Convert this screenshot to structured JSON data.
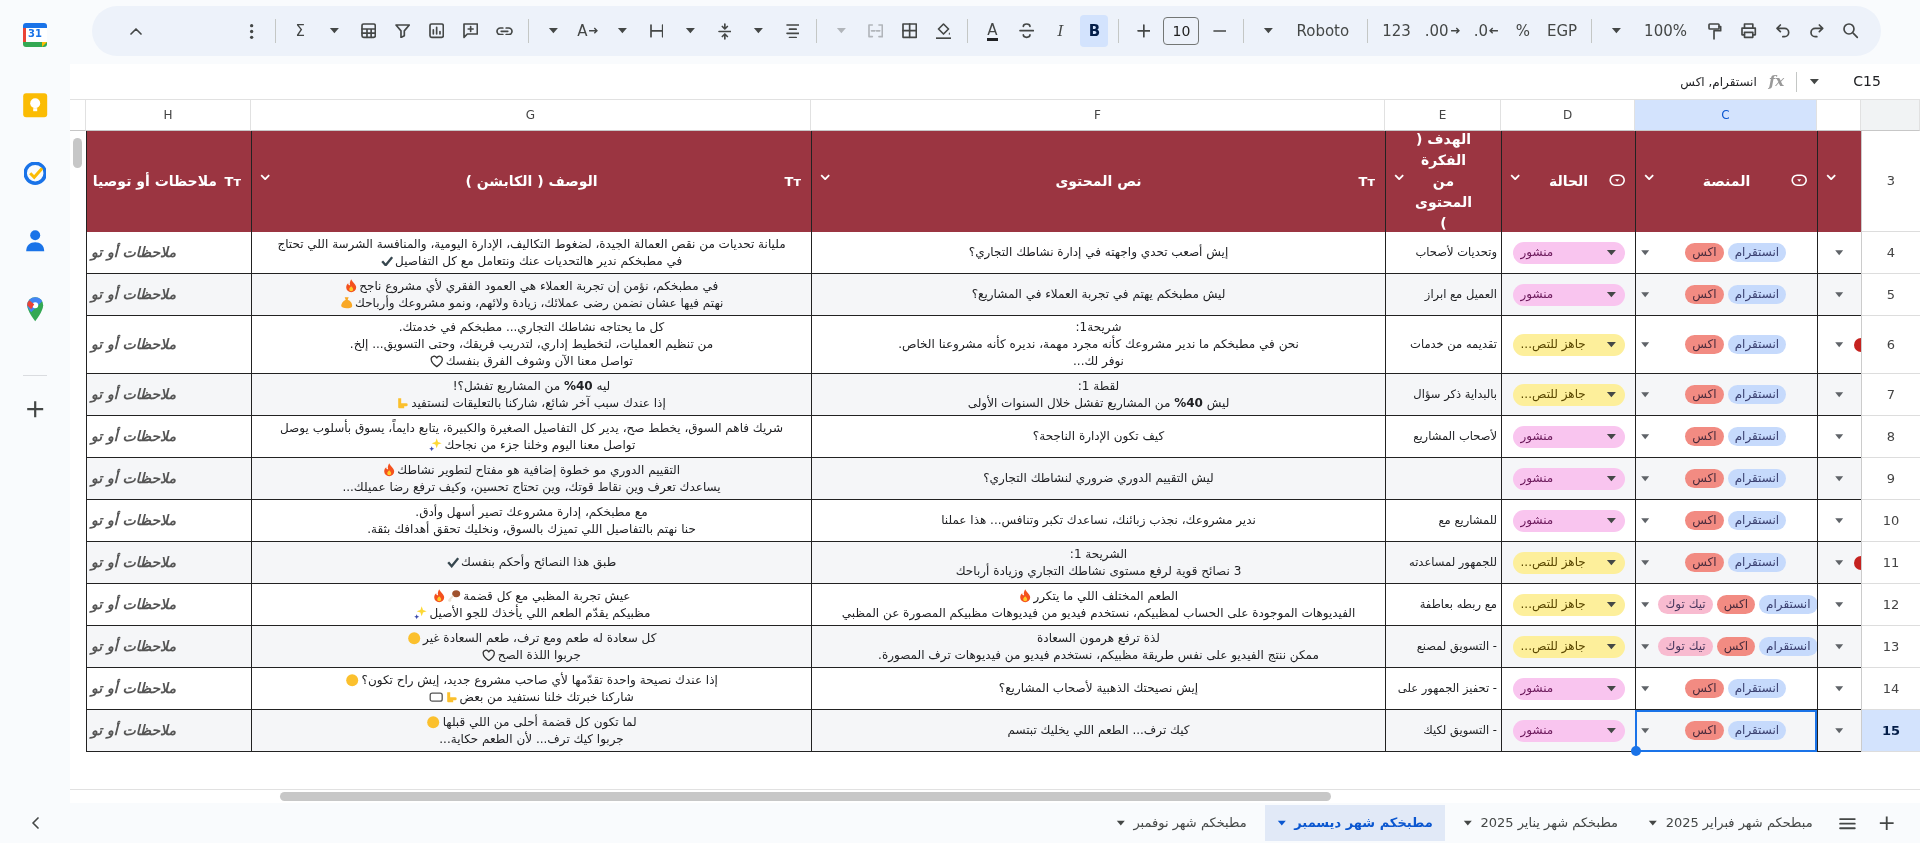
{
  "side_panel": {
    "calendar_day": "31",
    "apps": [
      {
        "kind": "calendar"
      },
      {
        "kind": "keep"
      },
      {
        "kind": "tasks"
      },
      {
        "kind": "contacts"
      },
      {
        "kind": "maps"
      },
      {
        "kind": "add"
      }
    ]
  },
  "toolbar": [
    {
      "kind": "search",
      "disabled": false,
      "active": false
    },
    {
      "kind": "redo",
      "disabled": false,
      "active": false
    },
    {
      "kind": "undo",
      "disabled": false,
      "active": false
    },
    {
      "kind": "print",
      "disabled": false,
      "active": false
    },
    {
      "kind": "paint_format",
      "disabled": false,
      "active": false
    },
    {
      "kind": "zoom",
      "label": "100%",
      "disabled": false,
      "active": false
    },
    {
      "kind": "caret",
      "disabled": false,
      "active": false
    },
    {
      "kind": "separator"
    },
    {
      "kind": "currency",
      "label": "EGP",
      "disabled": false,
      "active": false
    },
    {
      "kind": "percent",
      "label": "%",
      "disabled": false,
      "active": false
    },
    {
      "kind": "decimal_less",
      "label": ".0",
      "disabled": false,
      "active": false
    },
    {
      "kind": "decimal_more",
      "label": ".00",
      "disabled": false,
      "active": false
    },
    {
      "kind": "number_format",
      "label": "123",
      "disabled": false,
      "active": false
    },
    {
      "kind": "separator"
    },
    {
      "kind": "font",
      "label": "Roboto",
      "disabled": false,
      "active": false
    },
    {
      "kind": "caret",
      "disabled": false,
      "active": false
    },
    {
      "kind": "separator"
    },
    {
      "kind": "decrease",
      "disabled": false,
      "active": false
    },
    {
      "kind": "font_size",
      "value": "10",
      "disabled": false,
      "active": false
    },
    {
      "kind": "increase",
      "disabled": false,
      "active": false
    },
    {
      "kind": "separator"
    },
    {
      "kind": "bold",
      "label": "B",
      "disabled": false,
      "active": true
    },
    {
      "kind": "italic",
      "label": "I",
      "disabled": false,
      "active": false
    },
    {
      "kind": "strike",
      "disabled": false,
      "active": false
    },
    {
      "kind": "text_color",
      "label": "A",
      "disabled": false,
      "active": false
    },
    {
      "kind": "separator"
    },
    {
      "kind": "fill",
      "disabled": false,
      "active": false
    },
    {
      "kind": "borders",
      "disabled": false,
      "active": false
    },
    {
      "kind": "merge",
      "disabled": true,
      "active": false
    },
    {
      "kind": "caret",
      "disabled": true,
      "active": false
    },
    {
      "kind": "separator"
    },
    {
      "kind": "halign",
      "disabled": false,
      "active": false
    },
    {
      "kind": "caret",
      "disabled": false,
      "active": false
    },
    {
      "kind": "valign",
      "disabled": false,
      "active": false
    },
    {
      "kind": "caret",
      "disabled": false,
      "active": false
    },
    {
      "kind": "wrap",
      "disabled": false,
      "active": false
    },
    {
      "kind": "caret",
      "disabled": false,
      "active": false
    },
    {
      "kind": "rotate",
      "label": "A",
      "disabled": false,
      "active": false
    },
    {
      "kind": "caret",
      "disabled": false,
      "active": false
    },
    {
      "kind": "separator"
    },
    {
      "kind": "link",
      "disabled": false,
      "active": false
    },
    {
      "kind": "comment",
      "disabled": false,
      "active": false
    },
    {
      "kind": "chart",
      "disabled": false,
      "active": false
    },
    {
      "kind": "filter",
      "disabled": false,
      "active": false
    },
    {
      "kind": "table",
      "disabled": false,
      "active": false
    },
    {
      "kind": "caret",
      "disabled": false,
      "active": false
    },
    {
      "kind": "sum",
      "label": "Σ",
      "disabled": false,
      "active": false
    },
    {
      "kind": "separator"
    },
    {
      "kind": "more",
      "disabled": false,
      "active": false
    },
    {
      "kind": "spacer"
    },
    {
      "kind": "collapse",
      "disabled": false,
      "active": false
    }
  ],
  "formula_bar": {
    "name_box": "C15",
    "fx": "fx",
    "content": "انستقرام, اكس"
  },
  "columns": [
    {
      "selected": false
    },
    {
      "letter": "C",
      "selected": true
    },
    {
      "letter": "D",
      "selected": false
    },
    {
      "letter": "E",
      "selected": false
    },
    {
      "letter": "F",
      "selected": false
    },
    {
      "letter": "G",
      "selected": false
    },
    {
      "letter": "H",
      "selected": false
    }
  ],
  "header_row": {
    "number": "3",
    "cells": [
      {
        "kind": "empty",
        "filter_menu": true
      },
      {
        "kind": "dropdown",
        "label": "المنصة",
        "filter_menu": true
      },
      {
        "kind": "dropdown",
        "label": "الحالة",
        "filter_menu": true
      },
      {
        "kind": "text",
        "label": "الهدف ( الفكرة من المحتوى )",
        "filter_menu": true
      },
      {
        "kind": "text",
        "label": "نص المحتوى",
        "type_icon": "Tт",
        "filter_menu": true
      },
      {
        "kind": "text",
        "label": "الوصف ( الكابشن )",
        "type_icon": "Tт",
        "filter_menu": true
      },
      {
        "kind": "text",
        "label": "ملاحظات أو توصيا",
        "type_icon": "Tт",
        "filter_menu": false
      }
    ]
  },
  "rows": [
    {
      "number": "4",
      "selected": false,
      "flag": false,
      "notes": "ملاحظات أو تو",
      "caption": [
        {
          "text": "مليانة تحديات من نقص العمالة الجيدة، لضغوط التكاليف، الإدارة اليومية، والمنافسة الشرسة اللي تحتاج"
        },
        {
          "text": "في مطبخكم ندير هالتحديات عنك ونتعامل مع كل التفاصيل",
          "icons": [
            {
              "kind": "check"
            }
          ]
        }
      ],
      "content": [
        {
          "text": "إيش أصعب تحدي واجهته في إدارة نشاطك التجاري؟"
        }
      ],
      "goal": "وتحديات لأصحاب",
      "status": {
        "kind": "published",
        "label": "منشور"
      },
      "platforms": [
        {
          "label": "انستقرام",
          "color": "#c6dafc"
        },
        {
          "label": "اكس",
          "color": "#f28b82"
        }
      ]
    },
    {
      "number": "5",
      "selected": false,
      "flag": false,
      "notes": "ملاحظات أو تو",
      "caption": [
        {
          "text": "في مطبخكم، نؤمن إن تجربة العملاء هي العمود الفقري لأي مشروع ناجح",
          "icons": [
            {
              "kind": "fire"
            }
          ]
        },
        {
          "text": "نهتم فيها عشان نضمن رضى عملائك، زيادة ولائهم، ونمو مشروعك وأرباحك",
          "icons": [
            {
              "kind": "moneybag"
            }
          ]
        }
      ],
      "content": [
        {
          "text": "ليش مطبخكم يهتم في تجربة العملاء في المشاريع؟"
        }
      ],
      "goal": "العميل مع ابراز",
      "status": {
        "kind": "published",
        "label": "منشور"
      },
      "platforms": [
        {
          "label": "انستقرام",
          "color": "#c6dafc"
        },
        {
          "label": "اكس",
          "color": "#f28b82"
        }
      ]
    },
    {
      "number": "6",
      "selected": false,
      "flag": true,
      "notes": "ملاحظات أو تو",
      "caption": [
        {
          "text": "كل ما يحتاجه نشاطك التجاري... مطبخكم في خدمتك."
        },
        {
          "text": "من تنظيم العمليات، لتخطيط إداري، لتدريب فريقك، وحتى التسويق... إلخ."
        },
        {
          "text": "تواصل معنا الآن وشوف الفرق بنفسك",
          "icons": [
            {
              "kind": "heart"
            }
          ]
        }
      ],
      "content": [
        {
          "text": "شريحة1:"
        },
        {
          "text": "نحن في مطبخكم ما ندير مشروعك كأنه مجرد مهمة، نديره كأنه مشروعنا الخاص."
        },
        {
          "text": "نوفر لك..."
        }
      ],
      "goal": "تقديمه من خدمات",
      "status": {
        "kind": "ready",
        "label": "جاهز للتص..."
      },
      "platforms": [
        {
          "label": "انستقرام",
          "color": "#c6dafc"
        },
        {
          "label": "اكس",
          "color": "#f28b82"
        }
      ]
    },
    {
      "number": "7",
      "selected": false,
      "flag": false,
      "notes": "ملاحظات أو تو",
      "caption": [
        {
          "text": "ليه **40%** من المشاريع تفشل؟!"
        },
        {
          "text": "إذا عندك سبب آخر شائع، شاركنا بالتعليقات لنستفيد",
          "icons": [
            {
              "kind": "hand"
            }
          ]
        }
      ],
      "content": [
        {
          "text": "لقطة 1:"
        },
        {
          "text": "ليش **40%** من المشاريع تفشل خلال السنوات الأولى"
        }
      ],
      "goal": "بالبداية ذكر سؤال",
      "status": {
        "kind": "ready",
        "label": "جاهز للتص..."
      },
      "platforms": [
        {
          "label": "انستقرام",
          "color": "#c6dafc"
        },
        {
          "label": "اكس",
          "color": "#f28b82"
        }
      ]
    },
    {
      "number": "8",
      "selected": false,
      "flag": false,
      "notes": "ملاحظات أو تو",
      "caption": [
        {
          "text": "شريك فاهم السوق، يخطط صح، يدير كل التفاصيل الصغيرة والكبيرة، يتابع دايماً، يسوق بأسلوب يوصل"
        },
        {
          "text": "تواصل معنا اليوم وخلنا جزء من نجاحك",
          "icons": [
            {
              "kind": "sparkles"
            }
          ]
        }
      ],
      "content": [
        {
          "text": "كيف تكون الإدارة الناجحة؟"
        }
      ],
      "goal": "لأصحاب المشاريع",
      "status": {
        "kind": "published",
        "label": "منشور"
      },
      "platforms": [
        {
          "label": "انستقرام",
          "color": "#c6dafc"
        },
        {
          "label": "اكس",
          "color": "#f28b82"
        }
      ]
    },
    {
      "number": "9",
      "selected": false,
      "flag": false,
      "notes": "ملاحظات أو تو",
      "caption": [
        {
          "text": "التقييم الدوري مو خطوة إضافية هو مفتاح لتطوير نشاطك",
          "icons": [
            {
              "kind": "fire"
            }
          ]
        },
        {
          "text": "يساعدك تعرف وين نقاط قوتك، وين تحتاج تحسين، وكيف ترفع رضا عميلك..."
        }
      ],
      "content": [
        {
          "text": "ليش التقييم الدوري ضروري لنشاطك التجاري؟"
        }
      ],
      "status": {
        "kind": "published",
        "label": "منشور"
      },
      "platforms": [
        {
          "label": "انستقرام",
          "color": "#c6dafc"
        },
        {
          "label": "اكس",
          "color": "#f28b82"
        }
      ]
    },
    {
      "number": "10",
      "selected": false,
      "flag": false,
      "notes": "ملاحظات أو تو",
      "caption": [
        {
          "text": "مع مطبخكم، إدارة مشروعك تصير أسهل وأدق."
        },
        {
          "text": "حنا نهتم بالتفاصيل اللي تميزك بالسوق، ونخليك تحقق أهدافك بثقة."
        }
      ],
      "content": [
        {
          "text": "ندير مشروعك، نجذب زبائنك، نساعدك تكبر وتنافس... هذا عملنا"
        }
      ],
      "goal": "للمشاريع مع",
      "status": {
        "kind": "published",
        "label": "منشور"
      },
      "platforms": [
        {
          "label": "انستقرام",
          "color": "#c6dafc"
        },
        {
          "label": "اكس",
          "color": "#f28b82"
        }
      ]
    },
    {
      "number": "11",
      "selected": false,
      "flag": true,
      "notes": "ملاحظات أو تو",
      "caption": [
        {
          "text": "طبق هذا النصائح وأحكم بنفسك",
          "icons": [
            {
              "kind": "check"
            }
          ]
        }
      ],
      "content": [
        {
          "text": "الشريحة 1:"
        },
        {
          "text": "3 نصائح قوية لرفع مستوى نشاطك التجاري وزيادة أرباحك"
        }
      ],
      "goal": "للجمهور لمساعدته",
      "status": {
        "kind": "ready",
        "label": "جاهز للتص..."
      },
      "platforms": [
        {
          "label": "انستقرام",
          "color": "#c6dafc"
        },
        {
          "label": "اكس",
          "color": "#f28b82"
        }
      ]
    },
    {
      "number": "12",
      "selected": false,
      "flag": false,
      "notes": "ملاحظات أو تو",
      "caption": [
        {
          "text": "عيش تجربة المظبي مع كل قضمة",
          "icons": [
            {
              "kind": "drumstick"
            },
            {
              "kind": "fire"
            }
          ]
        },
        {
          "text": "مظبيكم يقدّم الطعم اللي يأخذك للجو الأصيل",
          "icons": [
            {
              "kind": "sparkles"
            }
          ]
        }
      ],
      "content": [
        {
          "text": "الطعم المختلف اللي ما يتكرر",
          "icons": [
            {
              "kind": "fire"
            }
          ]
        },
        {
          "text": "الفيديوهات الموجودة على الحساب لمظبيكم، نستخدم فيديو من فيديوهات مظبيكم المصورة عن المظبي"
        }
      ],
      "goal": "مع ربطه بعاطفة",
      "status": {
        "kind": "ready",
        "label": "جاهز للتص..."
      },
      "platforms": [
        {
          "label": "انستقرام",
          "color": "#c6dafc"
        },
        {
          "label": "اكس",
          "color": "#f28b82"
        },
        {
          "label": "تيك توك",
          "color": "#f8bbd0"
        }
      ]
    },
    {
      "number": "13",
      "selected": false,
      "flag": false,
      "notes": "ملاحظات أو تو",
      "caption": [
        {
          "text": "كل سعادة له طعم ومع ترف، طعم السعادة غير",
          "icons": [
            {
              "kind": "smile"
            }
          ]
        },
        {
          "text": "جربوا اللذة الصح",
          "icons": [
            {
              "kind": "heart"
            }
          ]
        }
      ],
      "content": [
        {
          "text": "لذة ترفع هرمون السعادة"
        },
        {
          "text": "ممكن ننتج الفيديو على نفس طريقة مظبيكم، نستخدم فيديو من فيديوهات ترف المصورة."
        }
      ],
      "goal": "- التسويق لمصنع",
      "status": {
        "kind": "ready",
        "label": "جاهز للتص..."
      },
      "platforms": [
        {
          "label": "انستقرام",
          "color": "#c6dafc"
        },
        {
          "label": "اكس",
          "color": "#f28b82"
        },
        {
          "label": "تيك توك",
          "color": "#f8bbd0"
        }
      ]
    },
    {
      "number": "14",
      "selected": false,
      "flag": false,
      "notes": "ملاحظات أو تو",
      "caption": [
        {
          "text": "إذا عندك نصيحة واحدة تقدّمها لأي صاحب مشروع جديد، إيش راح تكون؟",
          "icons": [
            {
              "kind": "thinking"
            }
          ]
        },
        {
          "text": "شاركنا خبرتك خلنا نستفيد من بعض",
          "icons": [
            {
              "kind": "hand"
            },
            {
              "kind": "speech"
            }
          ]
        }
      ],
      "content": [
        {
          "text": "إيش نصيحتك الذهبية لأصحاب المشاريع؟"
        }
      ],
      "goal": "- تحفيز الجمهور على",
      "status": {
        "kind": "published",
        "label": "منشور"
      },
      "platforms": [
        {
          "label": "انستقرام",
          "color": "#c6dafc"
        },
        {
          "label": "اكس",
          "color": "#f28b82"
        }
      ]
    },
    {
      "number": "15",
      "selected": true,
      "flag": false,
      "notes": "ملاحظات أو تو",
      "caption": [
        {
          "text": "لما تكون كل قضمة أحلى من اللي قبلها",
          "icons": [
            {
              "kind": "smile"
            }
          ]
        },
        {
          "text": "جربوا كيك ترف... لأن الطعم حكاية..."
        }
      ],
      "content": [
        {
          "text": "كيك ترف... الطعم اللي يخليك تبتسم"
        }
      ],
      "goal": "- التسويق لكيك",
      "status": {
        "kind": "published",
        "label": "منشور"
      },
      "platforms": [
        {
          "label": "انستقرام",
          "color": "#c6dafc"
        },
        {
          "label": "اكس",
          "color": "#f28b82"
        }
      ]
    }
  ],
  "sheet_tabs": {
    "add": "+",
    "tabs": [
      {
        "label": "مبطحكم شهر فبراير 2025",
        "selected": false
      },
      {
        "label": "مطبخكم شهر يناير 2025",
        "selected": false
      },
      {
        "label": "مطبخكم شهر ديسمبر",
        "selected": true
      },
      {
        "label": "مطبخكم شهر نوفمبر",
        "selected": false
      }
    ]
  }
}
